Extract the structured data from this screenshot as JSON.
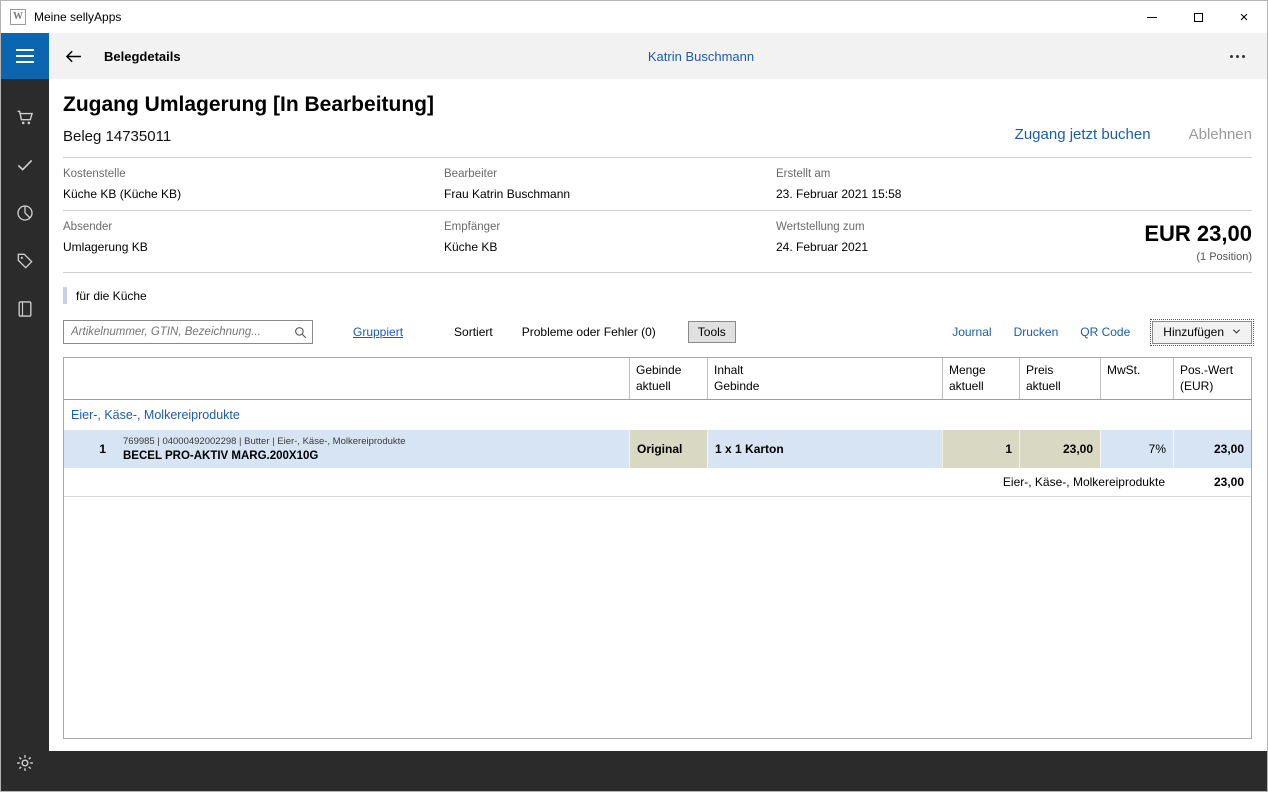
{
  "colors": {
    "accent_blue": "#1a5dab",
    "menu_blue": "#0b66af",
    "row_highlight": "#d6e4f4",
    "cell_khaki": "#d9d9c3",
    "dark_bar": "#2b2b2b"
  },
  "titlebar": {
    "app_title": "Meine sellyApps"
  },
  "appbar": {
    "title": "Belegdetails",
    "user": "Katrin Buschmann"
  },
  "doc": {
    "title": "Zugang Umlagerung [In Bearbeitung]",
    "beleg": "Beleg 14735011",
    "action_book": "Zugang jetzt buchen",
    "action_reject": "Ablehnen",
    "info": [
      {
        "label": "Kostenstelle",
        "value": "Küche KB (Küche KB)"
      },
      {
        "label": "Bearbeiter",
        "value": "Frau Katrin Buschmann"
      },
      {
        "label": "Erstellt am",
        "value": "23. Februar 2021 15:58"
      },
      {
        "label": "Absender",
        "value": "Umlagerung KB"
      },
      {
        "label": "Empfänger",
        "value": "Küche KB"
      },
      {
        "label": "Wertstellung zum",
        "value": "24. Februar 2021"
      }
    ],
    "total_amount": "EUR 23,00",
    "total_positions": "(1 Position)",
    "note": "für die Küche"
  },
  "toolbar": {
    "search_placeholder": "Artikelnummer, GTIN, Bezeichnung...",
    "grouped": "Gruppiert",
    "sorted": "Sortiert",
    "problems": "Probleme oder Fehler (0)",
    "tools": "Tools",
    "journal": "Journal",
    "print": "Drucken",
    "qr_code": "QR Code",
    "add": "Hinzufügen"
  },
  "table": {
    "headers": {
      "gebinde": "Gebinde\naktuell",
      "inhalt": "Inhalt\nGebinde",
      "menge": "Menge\naktuell",
      "preis": "Preis\naktuell",
      "mwst": "MwSt.",
      "poswert": "Pos.-Wert\n(EUR)"
    },
    "group_label": "Eier-, Käse-, Molkereiprodukte",
    "rows": [
      {
        "index": "1",
        "meta": "769985 | 04000492002298 | Butter | Eier-, Käse-, Molkereiprodukte",
        "name": "BECEL PRO-AKTIV MARG.200X10G",
        "gebinde": "Original",
        "inhalt": "1 x 1 Karton",
        "menge": "1",
        "preis": "23,00",
        "mwst": "7%",
        "poswert": "23,00"
      }
    ],
    "summary_label": "Eier-, Käse-, Molkereiprodukte",
    "summary_value": "23,00"
  }
}
